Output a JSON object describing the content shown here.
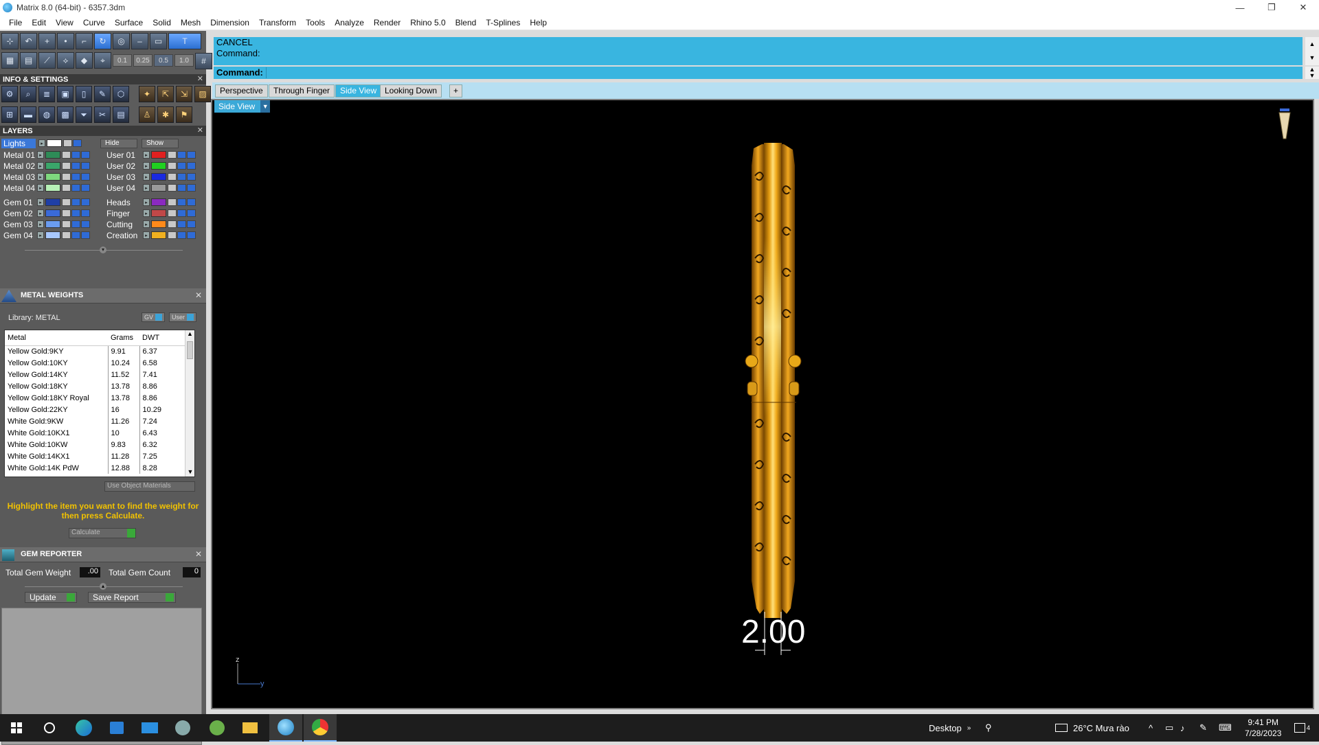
{
  "window": {
    "title": "Matrix 8.0 (64-bit) - 6357.3dm",
    "controls": [
      "—",
      "❐",
      "✕"
    ]
  },
  "menu": [
    "File",
    "Edit",
    "View",
    "Curve",
    "Surface",
    "Solid",
    "Mesh",
    "Dimension",
    "Transform",
    "Tools",
    "Analyze",
    "Render",
    "Rhino 5.0",
    "Blend",
    "T-Splines",
    "Help"
  ],
  "toolbar": {
    "snap_values": [
      "0.1",
      "0.25",
      "0.5",
      "1.0"
    ]
  },
  "info_settings": {
    "title": "INFO & SETTINGS",
    "close": "✕"
  },
  "layers": {
    "title": "LAYERS",
    "close": "✕",
    "lights_label": "Lights",
    "hide_label": "Hide",
    "show_label": "Show",
    "left": [
      {
        "name": "Metal 01",
        "color": "#2e8b57"
      },
      {
        "name": "Metal 02",
        "color": "#3aa66a"
      },
      {
        "name": "Metal 03",
        "color": "#7ed87e"
      },
      {
        "name": "Metal 04",
        "color": "#b7f0b7"
      },
      {
        "name": "Gem 01",
        "color": "#1f3fa6"
      },
      {
        "name": "Gem 02",
        "color": "#3a6ad8"
      },
      {
        "name": "Gem 03",
        "color": "#6a9cf0"
      },
      {
        "name": "Gem 04",
        "color": "#a8c8ff"
      }
    ],
    "right": [
      {
        "name": "User 01",
        "color": "#e02020"
      },
      {
        "name": "User 02",
        "color": "#20d020"
      },
      {
        "name": "User 03",
        "color": "#1a2ae0"
      },
      {
        "name": "User 04",
        "color": "#9a9a9a"
      },
      {
        "name": "Heads",
        "color": "#8a2ac0"
      },
      {
        "name": "Finger",
        "color": "#c04848"
      },
      {
        "name": "Cutting",
        "color": "#ff8a1a"
      },
      {
        "name": "Creation",
        "color": "#f0b020"
      }
    ]
  },
  "metal_weights": {
    "title": "METAL WEIGHTS",
    "close": "✕",
    "library": "Library: METAL",
    "gv_label": "GV",
    "user_label": "User",
    "columns": [
      "Metal",
      "Grams",
      "DWT"
    ],
    "rows": [
      [
        "Yellow Gold:9KY",
        "9.91",
        "6.37"
      ],
      [
        "Yellow Gold:10KY",
        "10.24",
        "6.58"
      ],
      [
        "Yellow Gold:14KY",
        "11.52",
        "7.41"
      ],
      [
        "Yellow Gold:18KY",
        "13.78",
        "8.86"
      ],
      [
        "Yellow Gold:18KY Royal",
        "13.78",
        "8.86"
      ],
      [
        "Yellow Gold:22KY",
        "16",
        "10.29"
      ],
      [
        "White Gold:9KW",
        "11.26",
        "7.24"
      ],
      [
        "White Gold:10KX1",
        "10",
        "6.43"
      ],
      [
        "White Gold:10KW",
        "9.83",
        "6.32"
      ],
      [
        "White Gold:14KX1",
        "11.28",
        "7.25"
      ],
      [
        "White Gold:14K PdW",
        "12.88",
        "8.28"
      ]
    ],
    "use_object_materials": "Use Object Materials",
    "hint": "Highlight the item you want to find the weight for then press Calculate.",
    "calculate": "Calculate"
  },
  "gem_reporter": {
    "title": "GEM REPORTER",
    "close": "✕",
    "total_weight_label": "Total Gem Weight",
    "total_weight_value": ".00",
    "total_count_label": "Total Gem Count",
    "total_count_value": "0",
    "update": "Update",
    "save_report": "Save Report"
  },
  "command": {
    "history_line1": "CANCEL",
    "history_line2": "Command:",
    "prompt": "Command:",
    "scroll_up": "▲",
    "scroll_down": "▼"
  },
  "view_tabs": [
    "Perspective",
    "Through Finger",
    "Side View",
    "Looking Down",
    "+"
  ],
  "active_tab": "Side View",
  "viewport": {
    "name": "Side View",
    "dimension_text": "2.00",
    "axis_z": "z",
    "axis_y": "y"
  },
  "taskbar": {
    "desktop_label": "Desktop",
    "weather": "26°C  Mưa rào",
    "time": "9:41 PM",
    "date": "7/28/2023",
    "notification_count": "4"
  },
  "colors": {
    "accent_blue": "#39b5e0",
    "gold": "#f5b21a",
    "hint_yellow": "#f2c200"
  }
}
